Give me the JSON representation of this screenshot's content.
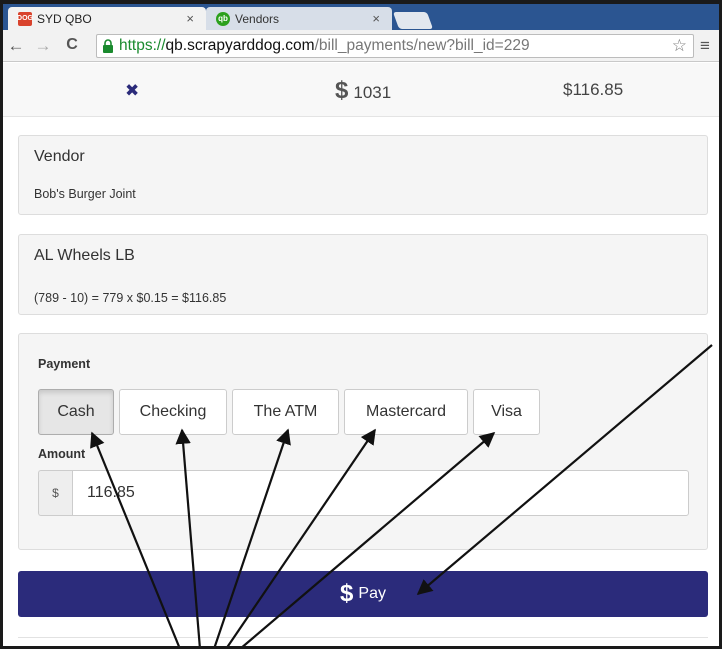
{
  "browser": {
    "tabs": [
      {
        "title": "SYD QBO",
        "favicon": "syd-logo-icon",
        "favicon_text": "DOG",
        "active": true
      },
      {
        "title": "Vendors",
        "favicon": "quickbooks-logo-icon",
        "favicon_text": "qb",
        "active": false
      }
    ],
    "url": {
      "scheme": "https://",
      "host": "qb.scrapyarddog.com",
      "path": "/bill_payments/new?bill_id=229"
    },
    "icons": {
      "back": "←",
      "forward": "→",
      "reload": "C",
      "star": "☆",
      "menu": "≡",
      "close_tab": "×"
    }
  },
  "summary": {
    "close_icon": "✖",
    "bill_symbol": "$",
    "bill_number": "1031",
    "total": "$116.85"
  },
  "vendor_panel": {
    "title": "Vendor",
    "name": "Bob's Burger Joint"
  },
  "item_panel": {
    "title": "AL Wheels LB",
    "calculation": "(789 - 10) = 779 x $0.15 = $116.85"
  },
  "payment_panel": {
    "payment_label": "Payment",
    "methods": [
      {
        "label": "Cash",
        "selected": true
      },
      {
        "label": "Checking",
        "selected": false
      },
      {
        "label": "The ATM",
        "selected": false
      },
      {
        "label": "Mastercard",
        "selected": false
      },
      {
        "label": "Visa",
        "selected": false
      }
    ],
    "amount_label": "Amount",
    "currency_addon": "$",
    "amount_value": "116.85"
  },
  "submit": {
    "symbol": "$",
    "label": "Pay"
  },
  "colors": {
    "primary": "#2b2b7b",
    "tabstrip": "#2b5591",
    "secure": "#1a8a2e"
  }
}
